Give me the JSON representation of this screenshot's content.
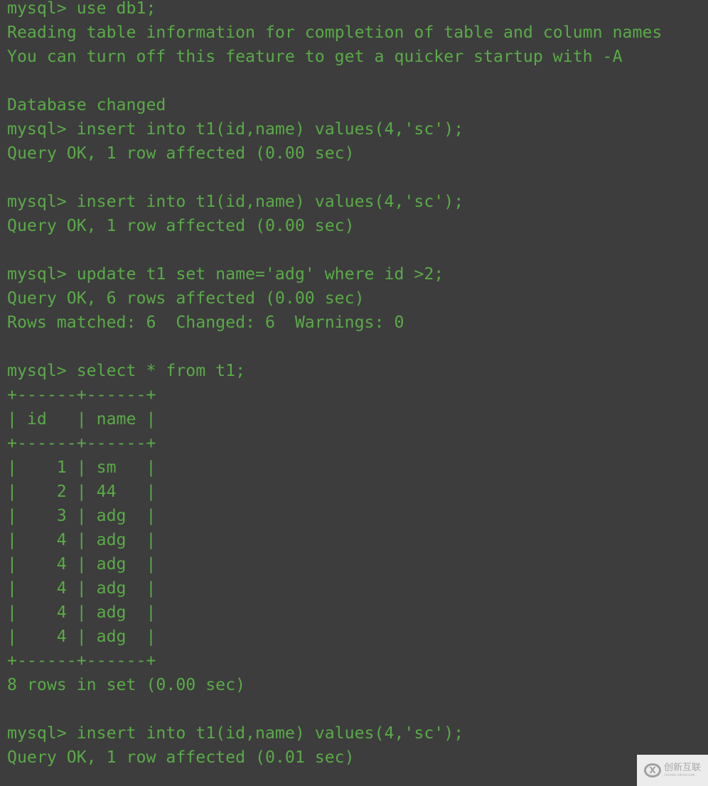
{
  "terminal": {
    "lines": [
      "mysql> use db1;",
      "Reading table information for completion of table and column names",
      "You can turn off this feature to get a quicker startup with -A",
      "",
      "Database changed",
      "mysql> insert into t1(id,name) values(4,'sc');",
      "Query OK, 1 row affected (0.00 sec)",
      "",
      "mysql> insert into t1(id,name) values(4,'sc');",
      "Query OK, 1 row affected (0.00 sec)",
      "",
      "mysql> update t1 set name='adg' where id >2;",
      "Query OK, 6 rows affected (0.00 sec)",
      "Rows matched: 6  Changed: 6  Warnings: 0",
      "",
      "mysql> select * from t1;",
      "+------+------+",
      "| id   | name |",
      "+------+------+",
      "|    1 | sm   |",
      "|    2 | 44   |",
      "|    3 | adg  |",
      "|    4 | adg  |",
      "|    4 | adg  |",
      "|    4 | adg  |",
      "|    4 | adg  |",
      "|    4 | adg  |",
      "+------+------+",
      "8 rows in set (0.00 sec)",
      "",
      "mysql> insert into t1(id,name) values(4,'sc');",
      "Query OK, 1 row affected (0.01 sec)"
    ]
  },
  "result_table": {
    "columns": [
      "id",
      "name"
    ],
    "rows": [
      [
        "1",
        "sm"
      ],
      [
        "2",
        "44"
      ],
      [
        "3",
        "adg"
      ],
      [
        "4",
        "adg"
      ],
      [
        "4",
        "adg"
      ],
      [
        "4",
        "adg"
      ],
      [
        "4",
        "adg"
      ],
      [
        "4",
        "adg"
      ]
    ]
  },
  "colors": {
    "background": "#3d3d3d",
    "text": "#5aaa48"
  },
  "watermark": {
    "logo_icon": "chuangxin-logo-icon",
    "logo_glyph": "X",
    "text": "创新互联",
    "subtext": "CHUANG XIN HU LIAN"
  }
}
